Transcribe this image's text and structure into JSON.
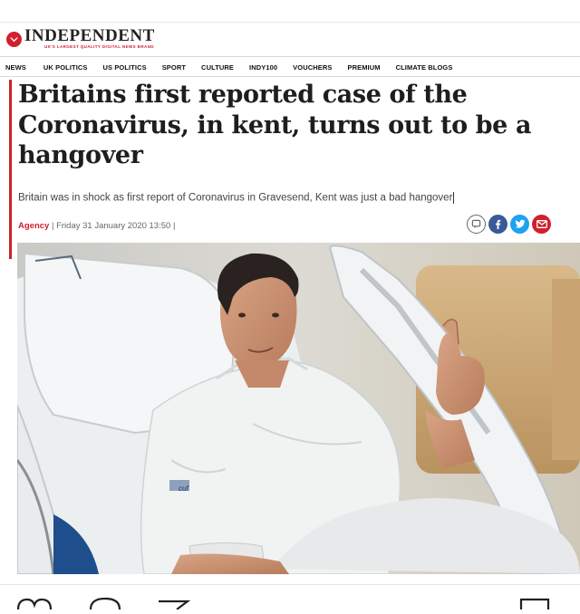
{
  "brand": {
    "name": "INDEPENDENT",
    "tagline": "UK'S LARGEST QUALITY DIGITAL NEWS BRAND"
  },
  "nav": {
    "items": [
      "NEWS",
      "UK POLITICS",
      "US POLITICS",
      "SPORT",
      "CULTURE",
      "INDY100",
      "VOUCHERS",
      "PREMIUM",
      "CLIMATE BLOGS"
    ]
  },
  "article": {
    "headline": "Britains first reported case of the Coronavirus, in kent, turns out to be a hangover",
    "standfirst": "Britain was in shock as first report of Coronavirus in Gravesend, Kent was just a bad hangover",
    "author": "Agency",
    "date": "Friday 31 January 2020 13:50",
    "image_caption_text": "cuf"
  },
  "share": {
    "icons": [
      "comment-icon",
      "facebook-icon",
      "twitter-icon",
      "email-icon"
    ]
  },
  "colors": {
    "brand_red": "#d0202e",
    "facebook_blue": "#3b5998",
    "twitter_blue": "#1da1f2"
  }
}
